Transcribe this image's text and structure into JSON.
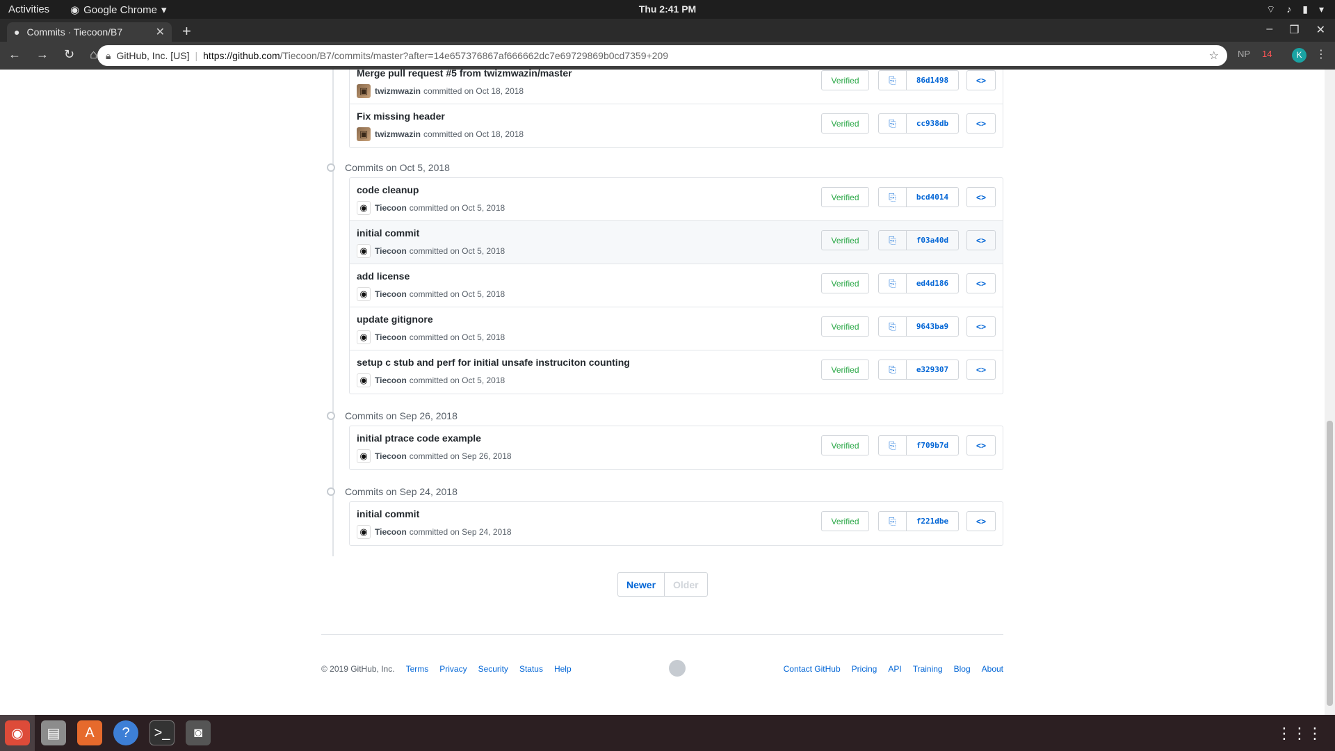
{
  "topbar": {
    "activities": "Activities",
    "app_name": "Google Chrome",
    "clock": "Thu  2:41 PM"
  },
  "browser": {
    "tab_title": "Commits · Tiecoon/B7",
    "org": "GitHub, Inc. [US]",
    "url_host": "https://github.com",
    "url_rest": "/Tiecoon/B7/commits/master?after=14e657376867af666662dc7e69729869b0cd7359+209",
    "ext_np": "NP",
    "ext_badge": "14",
    "profile_initial": "K"
  },
  "groups": [
    {
      "heading": "",
      "commits": [
        {
          "message": "Merge pull request #5 from twizmwazin/master",
          "author": "twizmwazin",
          "date": "committed on Oct 18, 2018",
          "verified": "Verified",
          "sha": "86d1498",
          "avatar": "photo",
          "highlight": false
        },
        {
          "message": "Fix missing header",
          "author": "twizmwazin",
          "date": "committed on Oct 18, 2018",
          "verified": "Verified",
          "sha": "cc938db",
          "avatar": "photo",
          "highlight": false
        }
      ]
    },
    {
      "heading": "Commits on Oct 5, 2018",
      "commits": [
        {
          "message": "code cleanup",
          "author": "Tiecoon",
          "date": "committed on Oct 5, 2018",
          "verified": "Verified",
          "sha": "bcd4014",
          "avatar": "eye",
          "highlight": false
        },
        {
          "message": "initial commit",
          "author": "Tiecoon",
          "date": "committed on Oct 5, 2018",
          "verified": "Verified",
          "sha": "f03a40d",
          "avatar": "eye",
          "highlight": true
        },
        {
          "message": "add license",
          "author": "Tiecoon",
          "date": "committed on Oct 5, 2018",
          "verified": "Verified",
          "sha": "ed4d186",
          "avatar": "eye",
          "highlight": false
        },
        {
          "message": "update gitignore",
          "author": "Tiecoon",
          "date": "committed on Oct 5, 2018",
          "verified": "Verified",
          "sha": "9643ba9",
          "avatar": "eye",
          "highlight": false
        },
        {
          "message": "setup c stub and perf for initial unsafe instruciton counting",
          "author": "Tiecoon",
          "date": "committed on Oct 5, 2018",
          "verified": "Verified",
          "sha": "e329307",
          "avatar": "eye",
          "highlight": false
        }
      ]
    },
    {
      "heading": "Commits on Sep 26, 2018",
      "commits": [
        {
          "message": "initial ptrace code example",
          "author": "Tiecoon",
          "date": "committed on Sep 26, 2018",
          "verified": "Verified",
          "sha": "f709b7d",
          "avatar": "eye",
          "highlight": false
        }
      ]
    },
    {
      "heading": "Commits on Sep 24, 2018",
      "commits": [
        {
          "message": "initial commit",
          "author": "Tiecoon",
          "date": "committed on Sep 24, 2018",
          "verified": "Verified",
          "sha": "f221dbe",
          "avatar": "eye",
          "highlight": false
        }
      ]
    }
  ],
  "pager": {
    "newer": "Newer",
    "older": "Older"
  },
  "footer": {
    "copyright": "© 2019 GitHub, Inc.",
    "left_links": [
      "Terms",
      "Privacy",
      "Security",
      "Status",
      "Help"
    ],
    "right_links": [
      "Contact GitHub",
      "Pricing",
      "API",
      "Training",
      "Blog",
      "About"
    ]
  },
  "colors": {
    "link": "#0366d6",
    "verified": "#28a745",
    "chrome_dark": "#3c3c3c"
  }
}
